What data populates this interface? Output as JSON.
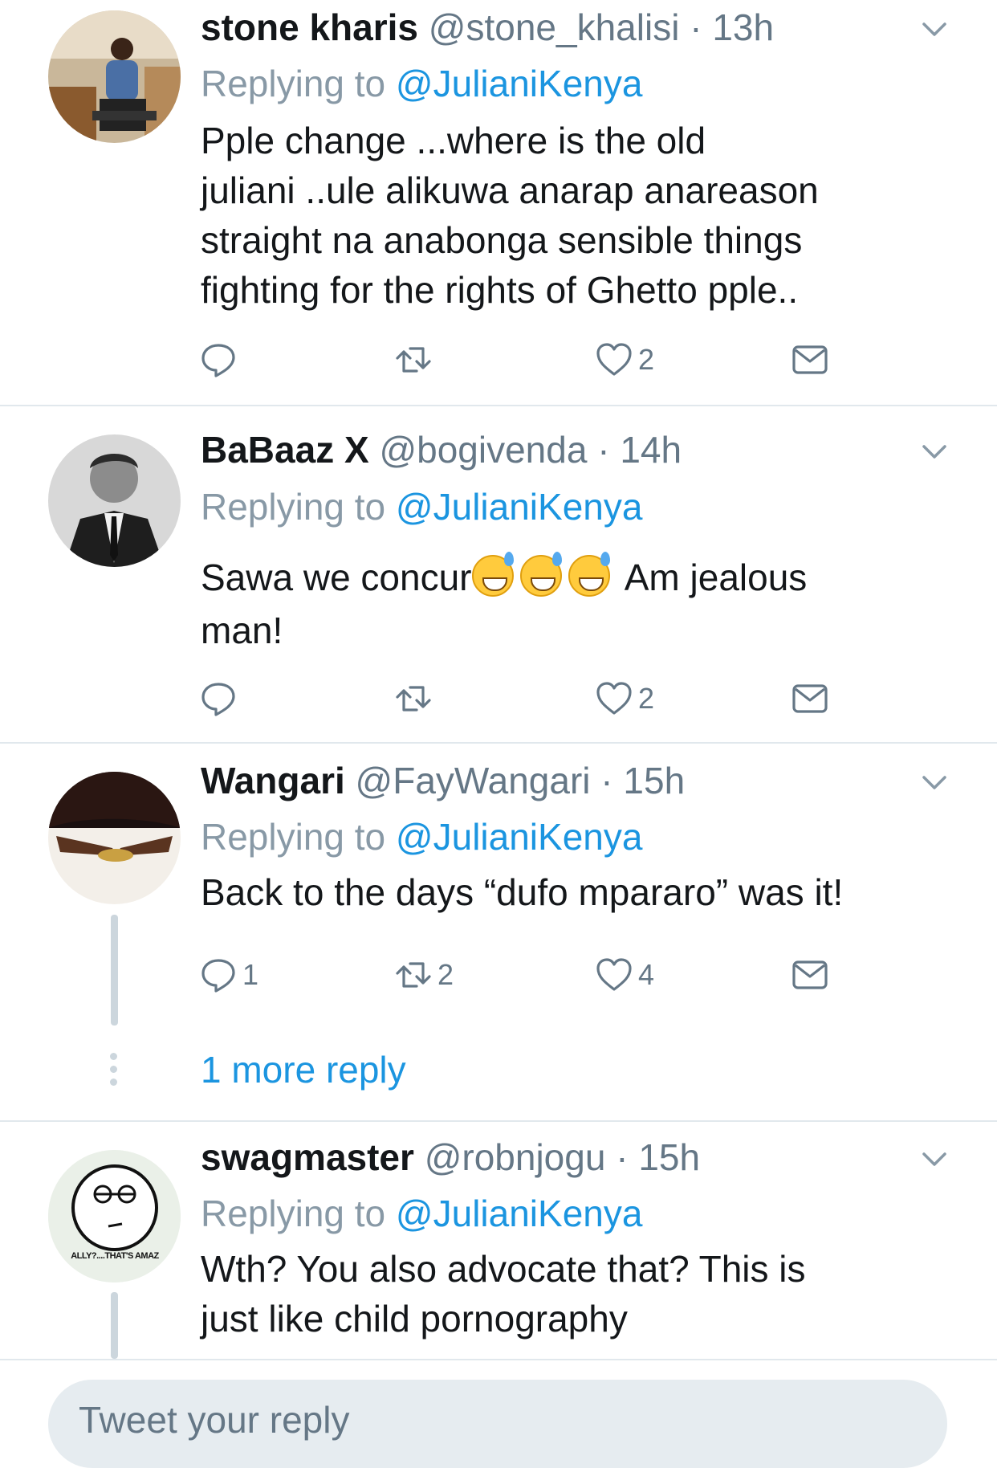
{
  "replying_prefix": "Replying to",
  "tweets": [
    {
      "name": "stone kharis",
      "handle": "@stone_khalisi",
      "time": "13h",
      "mention": "@JulianiKenya",
      "lines": [
        "Pple change ...where is the old",
        "juliani ..ule alikuwa anarap anareason",
        "straight na anabonga sensible things",
        "fighting for the rights of Ghetto pple.."
      ],
      "reply_count": "",
      "retweet_count": "",
      "like_count": "2"
    },
    {
      "name": "BaBaaz X",
      "handle": "@bogivenda",
      "time": "14h",
      "mention": "@JulianiKenya",
      "text_before_emoji": "Sawa we concur",
      "text_after_emoji": " Am jealous",
      "text_line2": "man!",
      "emoji_name": "grinning-face-with-sweat",
      "reply_count": "",
      "retweet_count": "",
      "like_count": "2"
    },
    {
      "name": "Wangari",
      "handle": "@FayWangari",
      "time": "15h",
      "mention": "@JulianiKenya",
      "lines": [
        "Back to the days “dufo mpararo” was it!"
      ],
      "reply_count": "1",
      "retweet_count": "2",
      "like_count": "4",
      "more_replies": "1 more reply"
    },
    {
      "name": "swagmaster",
      "handle": "@robnjogu",
      "time": "15h",
      "mention": "@JulianiKenya",
      "lines": [
        "Wth?  You also advocate that? This is",
        "just like child pornography"
      ],
      "avatar_caption": "ALLY?....THAT'S AMAZ"
    }
  ],
  "compose": {
    "placeholder": "Tweet your reply"
  },
  "colors": {
    "link": "#1b95e0",
    "muted": "#657786",
    "text": "#14171a",
    "separator": "#e1e8ed"
  },
  "icons": [
    "reply-icon",
    "retweet-icon",
    "like-icon",
    "direct-message-icon",
    "chevron-down-icon"
  ]
}
